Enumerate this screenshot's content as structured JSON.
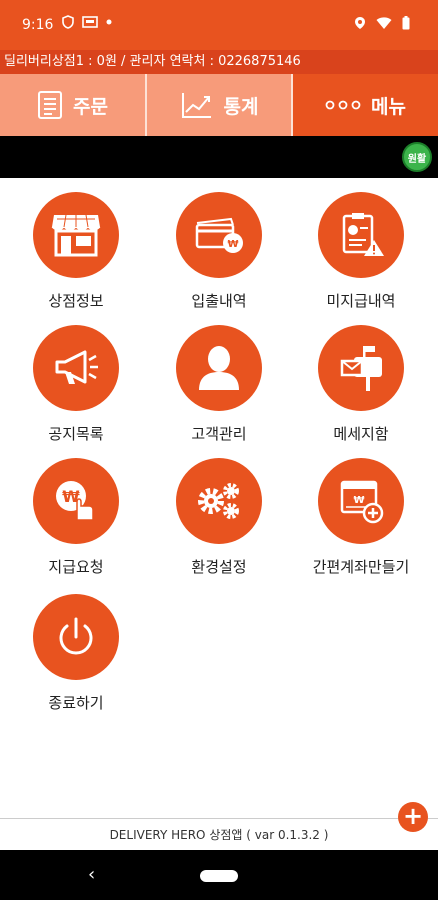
{
  "status_bar": {
    "time": "9:16"
  },
  "info_bar": {
    "text": "딜리버리상점1 : 0원 / 관리자 연락처 : 0226875146"
  },
  "tabs": [
    {
      "label": "주문",
      "icon": "document-icon"
    },
    {
      "label": "통계",
      "icon": "trend-chart-icon"
    },
    {
      "label": "메뉴",
      "icon": "dots-icon"
    }
  ],
  "status_badge": "원활",
  "menu": [
    {
      "label": "상점정보",
      "icon": "store-icon"
    },
    {
      "label": "입출내역",
      "icon": "payment-card-icon"
    },
    {
      "label": "미지급내역",
      "icon": "unpaid-document-icon"
    },
    {
      "label": "공지목록",
      "icon": "megaphone-icon"
    },
    {
      "label": "고객관리",
      "icon": "person-icon"
    },
    {
      "label": "메세지함",
      "icon": "mailbox-icon"
    },
    {
      "label": "지급요청",
      "icon": "payment-request-icon"
    },
    {
      "label": "환경설정",
      "icon": "gears-icon"
    },
    {
      "label": "간편계좌만들기",
      "icon": "account-add-icon"
    },
    {
      "label": "종료하기",
      "icon": "power-icon"
    }
  ],
  "footer": {
    "text": "DELIVERY HERO 상점앱 ( var 0.1.3.2 )"
  },
  "fab": {
    "label": "+"
  },
  "colors": {
    "brand": "#e8531f",
    "tab_inactive": "#f79b7a",
    "status_ok": "#3cb44b"
  }
}
